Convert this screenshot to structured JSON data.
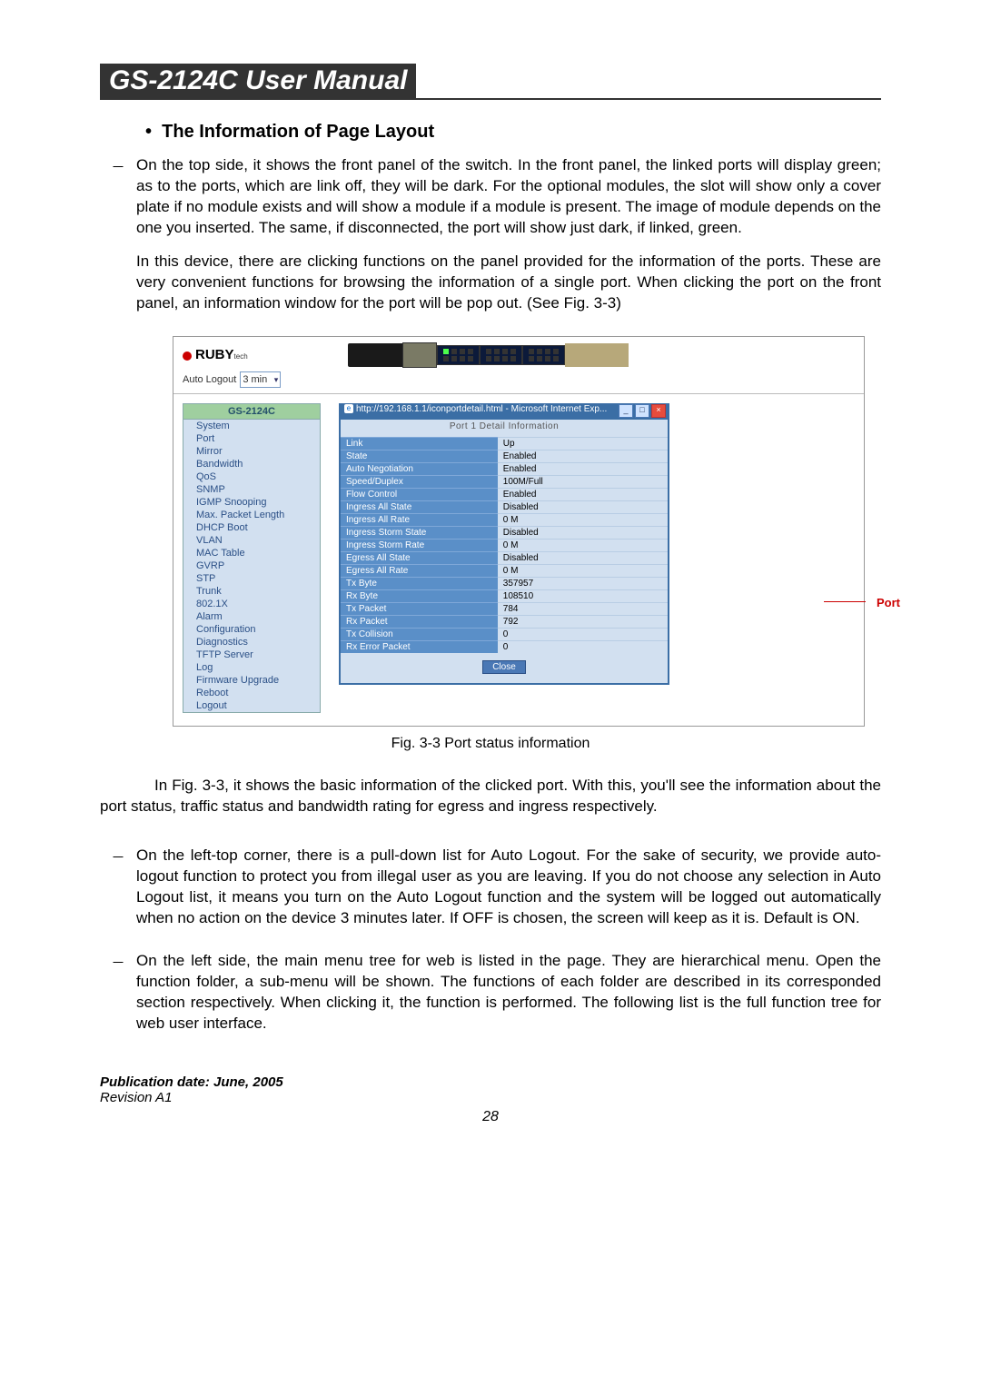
{
  "header": {
    "manual_title": "GS-2124C User Manual"
  },
  "section": {
    "bullet": "•",
    "title": "The Information of Page Layout"
  },
  "paragraphs": {
    "dash": "⎯",
    "p1": "On the top side, it shows the front panel of the switch. In the front panel, the linked ports will display green; as to the ports, which are link off, they will be dark. For the optional modules, the slot will show only a cover plate if no module exists and will show a module if a module is present. The image of module depends on the one you inserted. The same, if disconnected, the port will show just dark, if linked, green.",
    "p2": "In this device, there are clicking functions on the panel provided for the information of the ports. These are very convenient functions for browsing the information of a single port. When clicking the port on the front panel, an information window for the port will be pop out. (See Fig. 3-3)",
    "caption": "Fig. 3-3 Port status information",
    "p3": "In Fig. 3-3, it shows the basic information of the clicked port. With this, you'll see the information about the port status, traffic status and bandwidth rating for egress and ingress respectively.",
    "p4": "On the left-top corner, there is a pull-down list for Auto Logout. For the sake of security, we provide auto-logout function to protect you from illegal user as you are leaving. If you do not choose any selection in Auto Logout list, it means you turn on the Auto Logout function and the system will be logged out automatically when no action on the device 3 minutes later. If OFF is chosen, the screen will keep as it is. Default is ON.",
    "p5": "On the left side, the main menu tree for web is listed in the page. They are hierarchical menu. Open the function folder, a sub-menu will be shown. The functions of each folder are described in its corresponded section respectively. When clicking it, the function is performed. The following list is the full function tree for web user interface."
  },
  "shot": {
    "ruby": "RUBY",
    "auto_logout_label": "Auto Logout",
    "auto_logout_value": "3 min",
    "sidebar_head": "GS-2124C",
    "sidebar": [
      "System",
      "Port",
      "Mirror",
      "Bandwidth",
      "QoS",
      "SNMP",
      "IGMP Snooping",
      "Max. Packet Length",
      "DHCP Boot",
      "VLAN",
      "MAC Table",
      "GVRP",
      "STP",
      "Trunk",
      "802.1X",
      "Alarm",
      "Configuration",
      "Diagnostics",
      "TFTP Server",
      "Log",
      "Firmware Upgrade",
      "Reboot",
      "Logout"
    ],
    "ie_title": "http://192.168.1.1/iconportdetail.html - Microsoft Internet Exp...",
    "inner_title": "Port 1 Detail Information",
    "kv": [
      [
        "Link",
        "Up"
      ],
      [
        "State",
        "Enabled"
      ],
      [
        "Auto Negotiation",
        "Enabled"
      ],
      [
        "Speed/Duplex",
        "100M/Full"
      ],
      [
        "Flow Control",
        "Enabled"
      ],
      [
        "Ingress All State",
        "Disabled"
      ],
      [
        "Ingress All Rate",
        "0 M"
      ],
      [
        "Ingress Storm State",
        "Disabled"
      ],
      [
        "Ingress Storm Rate",
        "0 M"
      ],
      [
        "Egress All State",
        "Disabled"
      ],
      [
        "Egress All Rate",
        "0 M"
      ],
      [
        "Tx Byte",
        "357957"
      ],
      [
        "Rx Byte",
        "108510"
      ],
      [
        "Tx Packet",
        "784"
      ],
      [
        "Rx Packet",
        "792"
      ],
      [
        "Tx Collision",
        "0"
      ],
      [
        "Rx Error Packet",
        "0"
      ]
    ],
    "close": "Close",
    "annotation": "Port"
  },
  "footer": {
    "pub": "Publication date: June, 2005",
    "rev": "Revision A1",
    "page": "28"
  }
}
